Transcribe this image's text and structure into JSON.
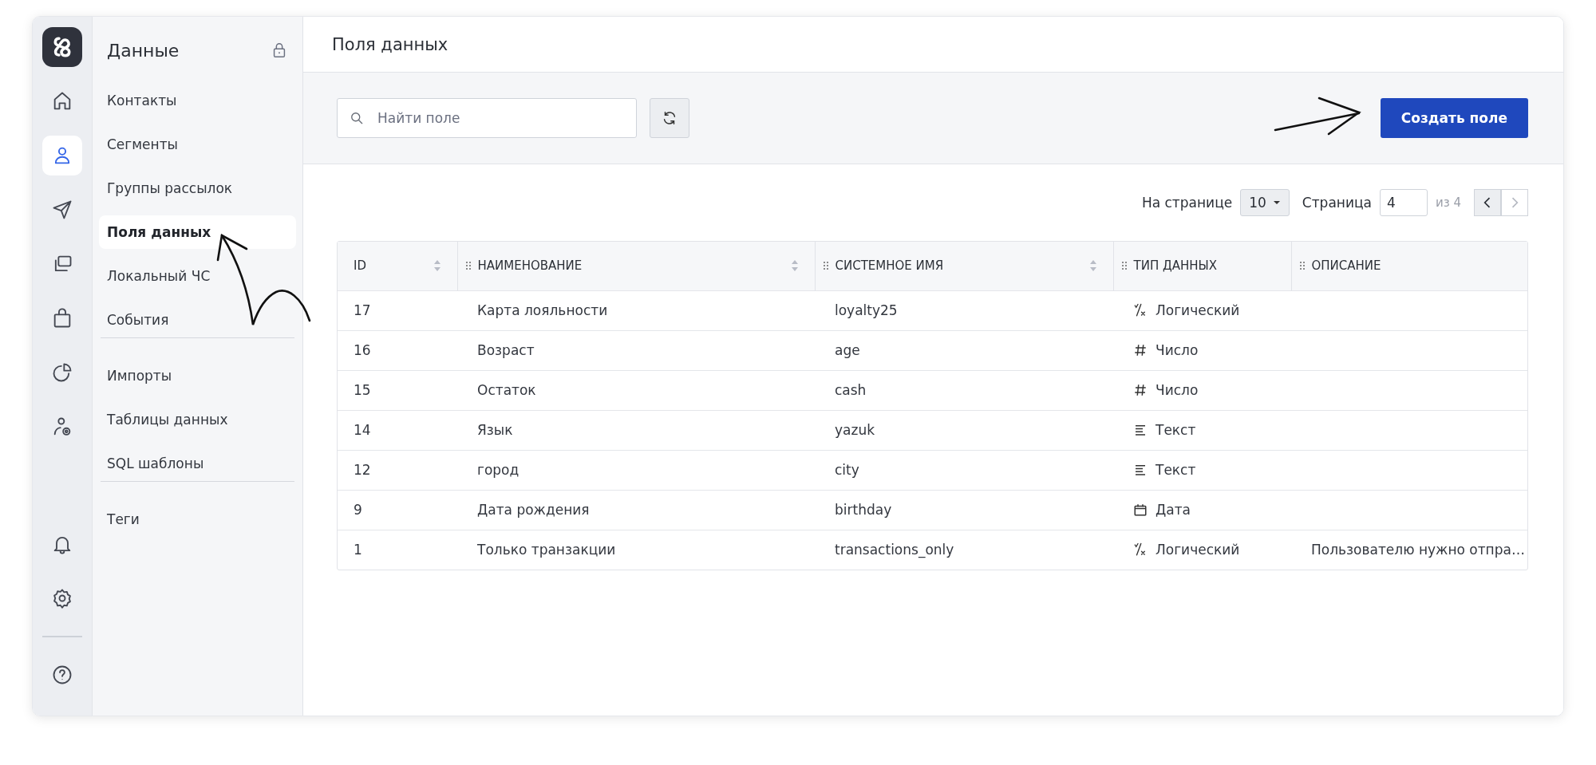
{
  "rail": {
    "top": [
      {
        "kind": "home",
        "selected": false
      },
      {
        "kind": "user",
        "selected": true
      },
      {
        "kind": "send",
        "selected": false
      },
      {
        "kind": "windows",
        "selected": false
      },
      {
        "kind": "bag",
        "selected": false
      },
      {
        "kind": "pie",
        "selected": false
      },
      {
        "kind": "user-gear",
        "selected": false
      }
    ],
    "bottom": [
      {
        "kind": "bell",
        "selected": false
      },
      {
        "kind": "gear",
        "selected": false
      }
    ],
    "help": {
      "kind": "help",
      "selected": false
    }
  },
  "nav": {
    "title": "Данные",
    "groups": [
      {
        "items": [
          {
            "label": "Контакты",
            "selected": false
          },
          {
            "label": "Сегменты",
            "selected": false
          },
          {
            "label": "Группы рассылок",
            "selected": false
          },
          {
            "label": "Поля данных",
            "selected": true
          },
          {
            "label": "Локальный ЧС",
            "selected": false
          },
          {
            "label": "События",
            "selected": false
          }
        ]
      },
      {
        "items": [
          {
            "label": "Импорты",
            "selected": false
          },
          {
            "label": "Таблицы данных",
            "selected": false
          },
          {
            "label": "SQL шаблоны",
            "selected": false
          }
        ]
      },
      {
        "items": [
          {
            "label": "Теги",
            "selected": false
          }
        ]
      }
    ]
  },
  "page": {
    "title": "Поля данных"
  },
  "toolbar": {
    "search": {
      "placeholder": "Найти поле"
    },
    "create_button": "Создать поле"
  },
  "pagination": {
    "per_page_label": "На странице",
    "per_page": "10",
    "page_label": "Страница",
    "page": "4",
    "of": "из 4",
    "prev_disabled": false,
    "next_disabled": true
  },
  "table": {
    "columns": [
      {
        "label": "ID",
        "draggable": false,
        "sortable": true
      },
      {
        "label": "НАИМЕНОВАНИЕ",
        "draggable": true,
        "sortable": true
      },
      {
        "label": "СИСТЕМНОЕ ИМЯ",
        "draggable": true,
        "sortable": true
      },
      {
        "label": "ТИП ДАННЫХ",
        "draggable": true,
        "sortable": false
      },
      {
        "label": "ОПИСАНИЕ",
        "draggable": true,
        "sortable": false
      }
    ],
    "rows": [
      {
        "id": "17",
        "name": "Карта лояльности",
        "system_name": "loyalty25",
        "type": {
          "kind": "boolean",
          "label": "Логический"
        }
      },
      {
        "id": "16",
        "name": "Возраст",
        "system_name": "age",
        "type": {
          "kind": "number",
          "label": "Число"
        }
      },
      {
        "id": "15",
        "name": "Остаток",
        "system_name": "cash",
        "type": {
          "kind": "number",
          "label": "Число"
        }
      },
      {
        "id": "14",
        "name": "Язык",
        "system_name": "yazuk",
        "type": {
          "kind": "text",
          "label": "Текст"
        }
      },
      {
        "id": "12",
        "name": "город",
        "system_name": "city",
        "type": {
          "kind": "text",
          "label": "Текст"
        }
      },
      {
        "id": "9",
        "name": "Дата рождения",
        "system_name": "birthday",
        "type": {
          "kind": "date",
          "label": "Дата"
        }
      },
      {
        "id": "1",
        "name": "Только транзакции",
        "system_name": "transactions_only",
        "type": {
          "kind": "boolean",
          "label": "Логический"
        },
        "description": "Пользователю нужно отпра…"
      }
    ]
  }
}
